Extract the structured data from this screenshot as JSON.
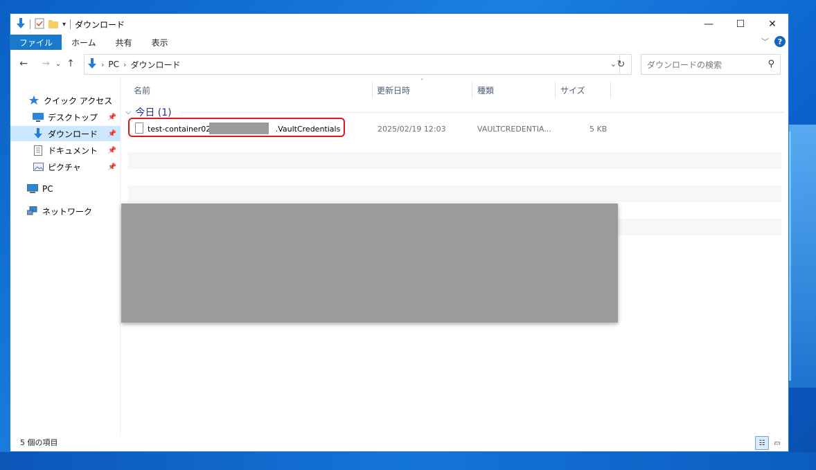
{
  "window": {
    "title": "ダウンロード",
    "controls": {
      "minimize": "—",
      "maximize": "☐",
      "close": "✕"
    }
  },
  "ribbon": {
    "tabs": [
      "ファイル",
      "ホーム",
      "共有",
      "表示"
    ],
    "help_label": "?"
  },
  "address": {
    "crumbs": [
      "PC",
      "ダウンロード"
    ],
    "search_placeholder": "ダウンロードの検索"
  },
  "sidebar": {
    "items": [
      {
        "label": "クイック アクセス",
        "icon": "star-icon",
        "pinned": false
      },
      {
        "label": "デスクトップ",
        "icon": "desktop-icon",
        "pinned": true
      },
      {
        "label": "ダウンロード",
        "icon": "download-icon",
        "pinned": true,
        "selected": true
      },
      {
        "label": "ドキュメント",
        "icon": "document-icon",
        "pinned": true
      },
      {
        "label": "ピクチャ",
        "icon": "pictures-icon",
        "pinned": true
      },
      {
        "label": "PC",
        "icon": "pc-icon",
        "pinned": false
      },
      {
        "label": "ネットワーク",
        "icon": "network-icon",
        "pinned": false
      }
    ]
  },
  "filelist": {
    "columns": [
      "名前",
      "更新日時",
      "種類",
      "サイズ"
    ],
    "group_label": "今日 (1)",
    "rows": [
      {
        "name_prefix": "test-container02_",
        "name_suffix": ".VaultCredentials",
        "date": "2025/02/19 12:03",
        "type": "VAULTCREDENTIA...",
        "size": "5 KB"
      }
    ]
  },
  "status": {
    "item_count": "5 個の項目"
  },
  "colors": {
    "accent": "#1979ca",
    "selected_bg": "#cce8ff",
    "highlight_border": "#e0151b",
    "redaction": "#9b9b9b"
  }
}
